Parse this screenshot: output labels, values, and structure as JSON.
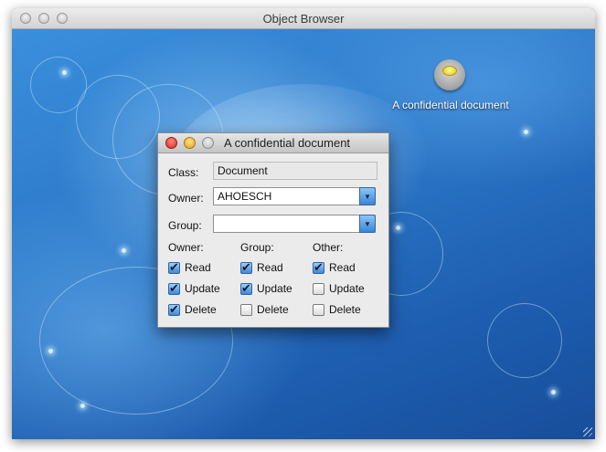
{
  "main_window": {
    "title": "Object Browser"
  },
  "desktop": {
    "document_icon": "document-object-icon",
    "document_label": "A confidential document"
  },
  "dialog": {
    "title": "A confidential document",
    "class_label": "Class:",
    "class_value": "Document",
    "owner_label": "Owner:",
    "owner_value": "AHOESCH",
    "group_label": "Group:",
    "group_value": "",
    "permissions": {
      "owner_header": "Owner:",
      "group_header": "Group:",
      "other_header": "Other:",
      "owner": {
        "read": {
          "label": "Read",
          "checked": true
        },
        "update": {
          "label": "Update",
          "checked": true
        },
        "delete": {
          "label": "Delete",
          "checked": true
        }
      },
      "group": {
        "read": {
          "label": "Read",
          "checked": true
        },
        "update": {
          "label": "Update",
          "checked": true
        },
        "delete": {
          "label": "Delete",
          "checked": false
        }
      },
      "other": {
        "read": {
          "label": "Read",
          "checked": true
        },
        "update": {
          "label": "Update",
          "checked": false
        },
        "delete": {
          "label": "Delete",
          "checked": false
        }
      }
    }
  },
  "colors": {
    "desktop_blue": "#2c78c8",
    "dialog_bg": "#ebebeb",
    "checkbox_on": "#3f88d6"
  }
}
